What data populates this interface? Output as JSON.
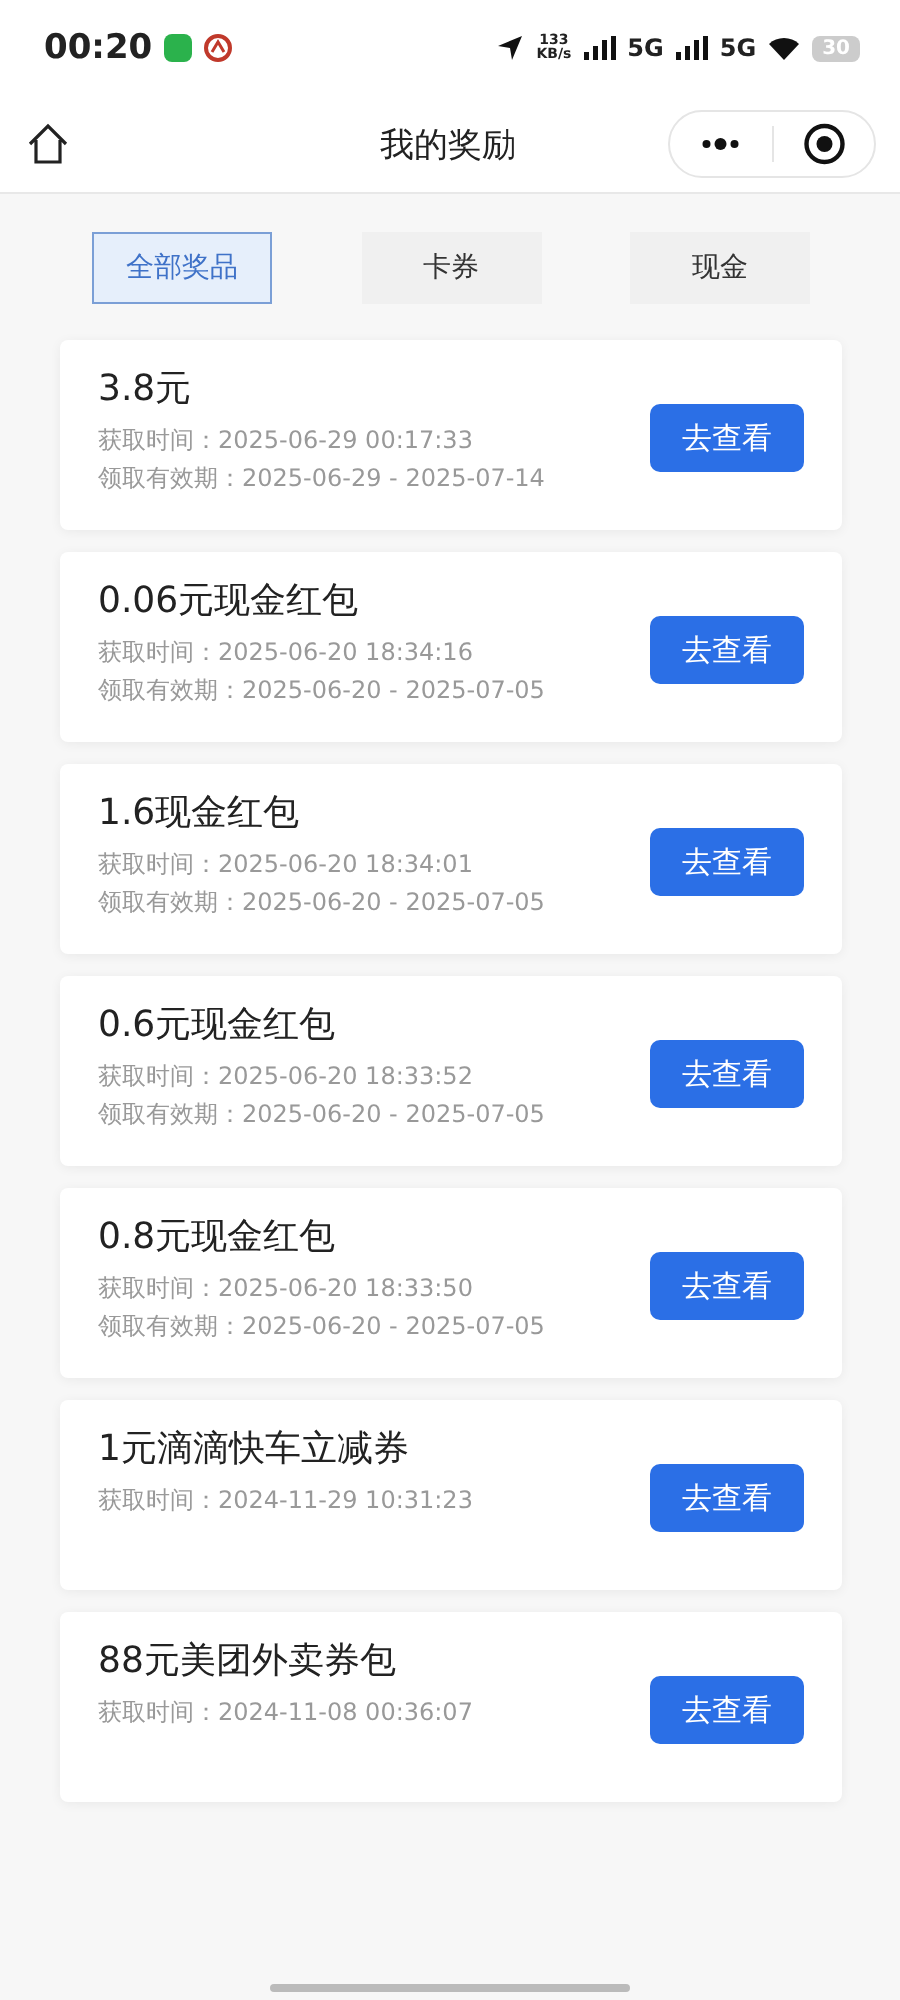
{
  "status_bar": {
    "time": "00:20",
    "speed_value": "133",
    "speed_unit": "KB/s",
    "network_1": "5G",
    "network_2": "5G",
    "battery": "30"
  },
  "nav": {
    "title": "我的奖励"
  },
  "tabs": [
    {
      "label": "全部奖品",
      "selected": true
    },
    {
      "label": "卡券",
      "selected": false
    },
    {
      "label": "现金",
      "selected": false
    }
  ],
  "rewards": [
    {
      "title": "3.8元",
      "details": [
        "获取时间：2025-06-29 00:17:33",
        "领取有效期：2025-06-29 - 2025-07-14"
      ],
      "button": "去查看"
    },
    {
      "title": "0.06元现金红包",
      "details": [
        "获取时间：2025-06-20 18:34:16",
        "领取有效期：2025-06-20 - 2025-07-05"
      ],
      "button": "去查看"
    },
    {
      "title": "1.6现金红包",
      "details": [
        "获取时间：2025-06-20 18:34:01",
        "领取有效期：2025-06-20 - 2025-07-05"
      ],
      "button": "去查看"
    },
    {
      "title": "0.6元现金红包",
      "details": [
        "获取时间：2025-06-20 18:33:52",
        "领取有效期：2025-06-20 - 2025-07-05"
      ],
      "button": "去查看"
    },
    {
      "title": "0.8元现金红包",
      "details": [
        "获取时间：2025-06-20 18:33:50",
        "领取有效期：2025-06-20 - 2025-07-05"
      ],
      "button": "去查看"
    },
    {
      "title": "1元滴滴快车立减券",
      "details": [
        "获取时间：2024-11-29 10:31:23"
      ],
      "button": "去查看"
    },
    {
      "title": "88元美团外卖券包",
      "details": [
        "获取时间：2024-11-08 00:36:07"
      ],
      "button": "去查看"
    }
  ]
}
